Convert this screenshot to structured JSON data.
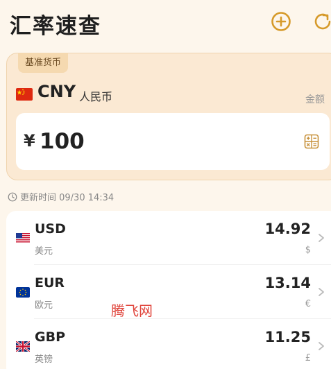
{
  "header": {
    "title": "汇率速查",
    "add_icon": "plus-circle-icon",
    "refresh_icon": "refresh-icon",
    "accent_color": "#d69a2a"
  },
  "base": {
    "tag": "基准货币",
    "flag": "cn-flag",
    "code": "CNY",
    "name": "人民币",
    "amount_label": "金额",
    "symbol": "¥",
    "amount": "100",
    "calc_icon": "calculator-icon"
  },
  "update_time": "更新时间 09/30 14:34",
  "rates": [
    {
      "flag": "us-flag",
      "code": "USD",
      "name": "美元",
      "value": "14.92",
      "symbol": "$"
    },
    {
      "flag": "eu-flag",
      "code": "EUR",
      "name": "欧元",
      "value": "13.14",
      "symbol": "€"
    },
    {
      "flag": "uk-flag",
      "code": "GBP",
      "name": "英镑",
      "value": "11.25",
      "symbol": "£"
    }
  ],
  "watermark": "腾飞网"
}
